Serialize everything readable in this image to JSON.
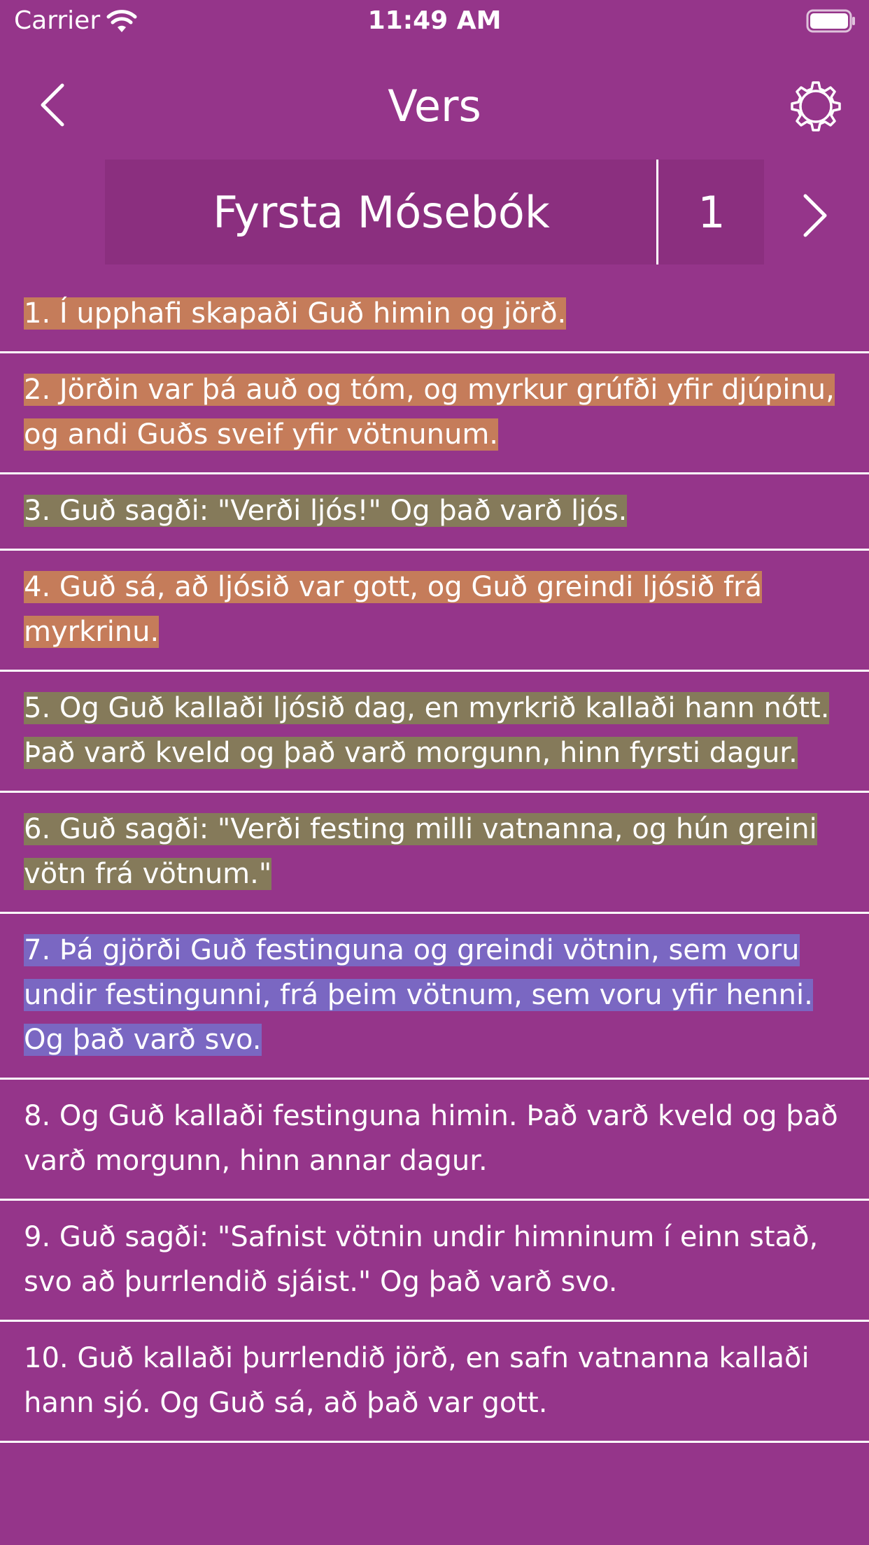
{
  "status_bar": {
    "carrier": "Carrier",
    "time": "11:49 AM",
    "icons": [
      "wifi-icon",
      "battery-icon"
    ]
  },
  "nav": {
    "title": "Vers",
    "back_icon": "chevron-left-icon",
    "settings_icon": "gear-icon"
  },
  "selector": {
    "book": "Fyrsta Mósebók",
    "chapter": "1",
    "next_icon": "chevron-right-icon"
  },
  "colors": {
    "background": "#95358A",
    "selector_bg": "#8B2F7F",
    "highlight_orange": "#C57C5A",
    "highlight_olive": "#857A5A",
    "highlight_blue": "#7A67C2"
  },
  "verses": [
    {
      "text": "1. Í upphafi skapaði Guð himin og jörð.",
      "highlight": "orange"
    },
    {
      "text": "2. Jörðin var þá auð og tóm, og myrkur grúfði yfir djúpinu, og andi Guðs sveif yfir vötnunum.",
      "highlight": "orange"
    },
    {
      "text": "3. Guð sagði: \"Verði ljós!\" Og það varð ljós.",
      "highlight": "olive"
    },
    {
      "text": "4. Guð sá, að ljósið var gott, og Guð greindi ljósið frá myrkrinu.",
      "highlight": "orange"
    },
    {
      "text": "5. Og Guð kallaði ljósið dag, en myrkrið kallaði hann nótt. Það varð kveld og það varð morgunn, hinn fyrsti dagur.",
      "highlight": "olive"
    },
    {
      "text": "6. Guð sagði: \"Verði festing milli vatnanna, og hún greini vötn frá vötnum.\"",
      "highlight": "olive"
    },
    {
      "text": "7. Þá gjörði Guð festinguna og greindi vötnin, sem voru undir festingunni, frá þeim vötnum, sem voru yfir henni. Og það varð svo.",
      "highlight": "blue"
    },
    {
      "text": "8. Og Guð kallaði festinguna himin. Það varð kveld og það varð morgunn, hinn annar dagur.",
      "highlight": "none"
    },
    {
      "text": "9. Guð sagði: \"Safnist vötnin undir himninum í einn stað, svo að þurrlendið sjáist.\" Og það varð svo.",
      "highlight": "none"
    },
    {
      "text": "10. Guð kallaði þurrlendið jörð, en safn vatnanna kallaði hann sjó. Og Guð sá, að það var gott.",
      "highlight": "none"
    }
  ]
}
